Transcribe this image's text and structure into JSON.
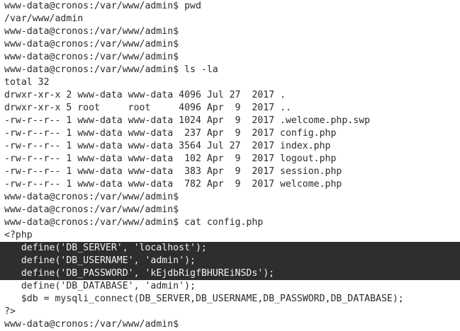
{
  "terminal": {
    "lines": [
      {
        "text": "www-data@cronos:/var/www/admin$ pwd",
        "highlight": false
      },
      {
        "text": "/var/www/admin",
        "highlight": false
      },
      {
        "text": "www-data@cronos:/var/www/admin$",
        "highlight": false
      },
      {
        "text": "www-data@cronos:/var/www/admin$",
        "highlight": false
      },
      {
        "text": "www-data@cronos:/var/www/admin$",
        "highlight": false
      },
      {
        "text": "www-data@cronos:/var/www/admin$ ls -la",
        "highlight": false
      },
      {
        "text": "total 32",
        "highlight": false
      },
      {
        "text": "drwxr-xr-x 2 www-data www-data 4096 Jul 27  2017 .",
        "highlight": false
      },
      {
        "text": "drwxr-xr-x 5 root     root     4096 Apr  9  2017 ..",
        "highlight": false
      },
      {
        "text": "-rw-r--r-- 1 www-data www-data 1024 Apr  9  2017 .welcome.php.swp",
        "highlight": false
      },
      {
        "text": "-rw-r--r-- 1 www-data www-data  237 Apr  9  2017 config.php",
        "highlight": false
      },
      {
        "text": "-rw-r--r-- 1 www-data www-data 3564 Jul 27  2017 index.php",
        "highlight": false
      },
      {
        "text": "-rw-r--r-- 1 www-data www-data  102 Apr  9  2017 logout.php",
        "highlight": false
      },
      {
        "text": "-rw-r--r-- 1 www-data www-data  383 Apr  9  2017 session.php",
        "highlight": false
      },
      {
        "text": "-rw-r--r-- 1 www-data www-data  782 Apr  9  2017 welcome.php",
        "highlight": false
      },
      {
        "text": "www-data@cronos:/var/www/admin$",
        "highlight": false
      },
      {
        "text": "www-data@cronos:/var/www/admin$",
        "highlight": false
      },
      {
        "text": "www-data@cronos:/var/www/admin$ cat config.php",
        "highlight": false
      },
      {
        "text": "<?php",
        "highlight": false
      },
      {
        "text": "   define('DB_SERVER', 'localhost');",
        "highlight": true
      },
      {
        "text": "   define('DB_USERNAME', 'admin');",
        "highlight": true
      },
      {
        "text": "   define('DB_PASSWORD', 'kEjdbRigfBHUREiNSDs');",
        "highlight": true
      },
      {
        "text": "   define('DB_DATABASE', 'admin');",
        "highlight": false
      },
      {
        "text": "   $db = mysqli_connect(DB_SERVER,DB_USERNAME,DB_PASSWORD,DB_DATABASE);",
        "highlight": false
      },
      {
        "text": "?>",
        "highlight": false
      },
      {
        "text": "www-data@cronos:/var/www/admin$",
        "highlight": false
      }
    ]
  }
}
